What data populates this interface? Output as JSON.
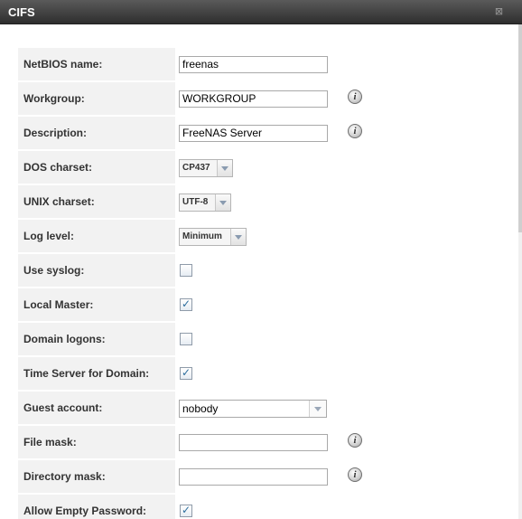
{
  "window": {
    "title": "CIFS",
    "close_glyph": "⊠"
  },
  "fields": {
    "netbios_name": {
      "label": "NetBIOS name:",
      "value": "freenas"
    },
    "workgroup": {
      "label": "Workgroup:",
      "value": "WORKGROUP"
    },
    "description": {
      "label": "Description:",
      "value": "FreeNAS Server"
    },
    "dos_charset": {
      "label": "DOS charset:",
      "value": "CP437"
    },
    "unix_charset": {
      "label": "UNIX charset:",
      "value": "UTF-8"
    },
    "log_level": {
      "label": "Log level:",
      "value": "Minimum"
    },
    "use_syslog": {
      "label": "Use syslog:",
      "checked": false
    },
    "local_master": {
      "label": "Local Master:",
      "checked": true
    },
    "domain_logons": {
      "label": "Domain logons:",
      "checked": false
    },
    "time_server": {
      "label": "Time Server for Domain:",
      "checked": true
    },
    "guest_account": {
      "label": "Guest account:",
      "value": "nobody"
    },
    "file_mask": {
      "label": "File mask:",
      "value": ""
    },
    "directory_mask": {
      "label": "Directory mask:",
      "value": ""
    },
    "allow_empty_password": {
      "label": "Allow Empty Password:",
      "checked": true
    }
  },
  "icons": {
    "info": "i",
    "check": "✓"
  }
}
